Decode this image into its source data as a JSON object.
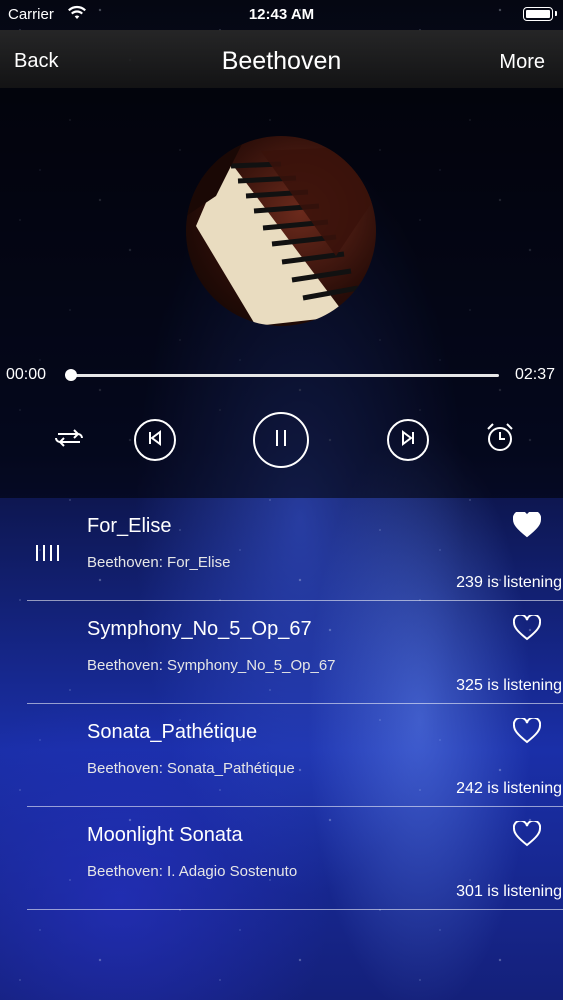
{
  "status": {
    "carrier": "Carrier",
    "time": "12:43 AM"
  },
  "nav": {
    "back": "Back",
    "title": "Beethoven",
    "more": "More"
  },
  "player": {
    "current_time": "00:00",
    "total_time": "02:37",
    "progress": 0,
    "state": "playing"
  },
  "songs": [
    {
      "title": "For_Elise",
      "subtitle": "Beethoven: For_Elise",
      "listening": "239 is listening",
      "favorite": true,
      "playing": true
    },
    {
      "title": "Symphony_No_5_Op_67",
      "subtitle": "Beethoven: Symphony_No_5_Op_67",
      "listening": "325 is listening",
      "favorite": false,
      "playing": false
    },
    {
      "title": "Sonata_Pathétique",
      "subtitle": "Beethoven: Sonata_Pathétique",
      "listening": "242 is listening",
      "favorite": false,
      "playing": false
    },
    {
      "title": "Moonlight Sonata",
      "subtitle": "Beethoven: I. Adagio Sostenuto",
      "listening": "301 is listening",
      "favorite": false,
      "playing": false
    }
  ],
  "icons": {
    "repeat": "repeat-icon",
    "previous": "previous-icon",
    "pause": "pause-icon",
    "next": "next-icon",
    "alarm": "alarm-clock-icon",
    "heart": "heart-icon",
    "now_playing": "now-playing-bars-icon"
  }
}
